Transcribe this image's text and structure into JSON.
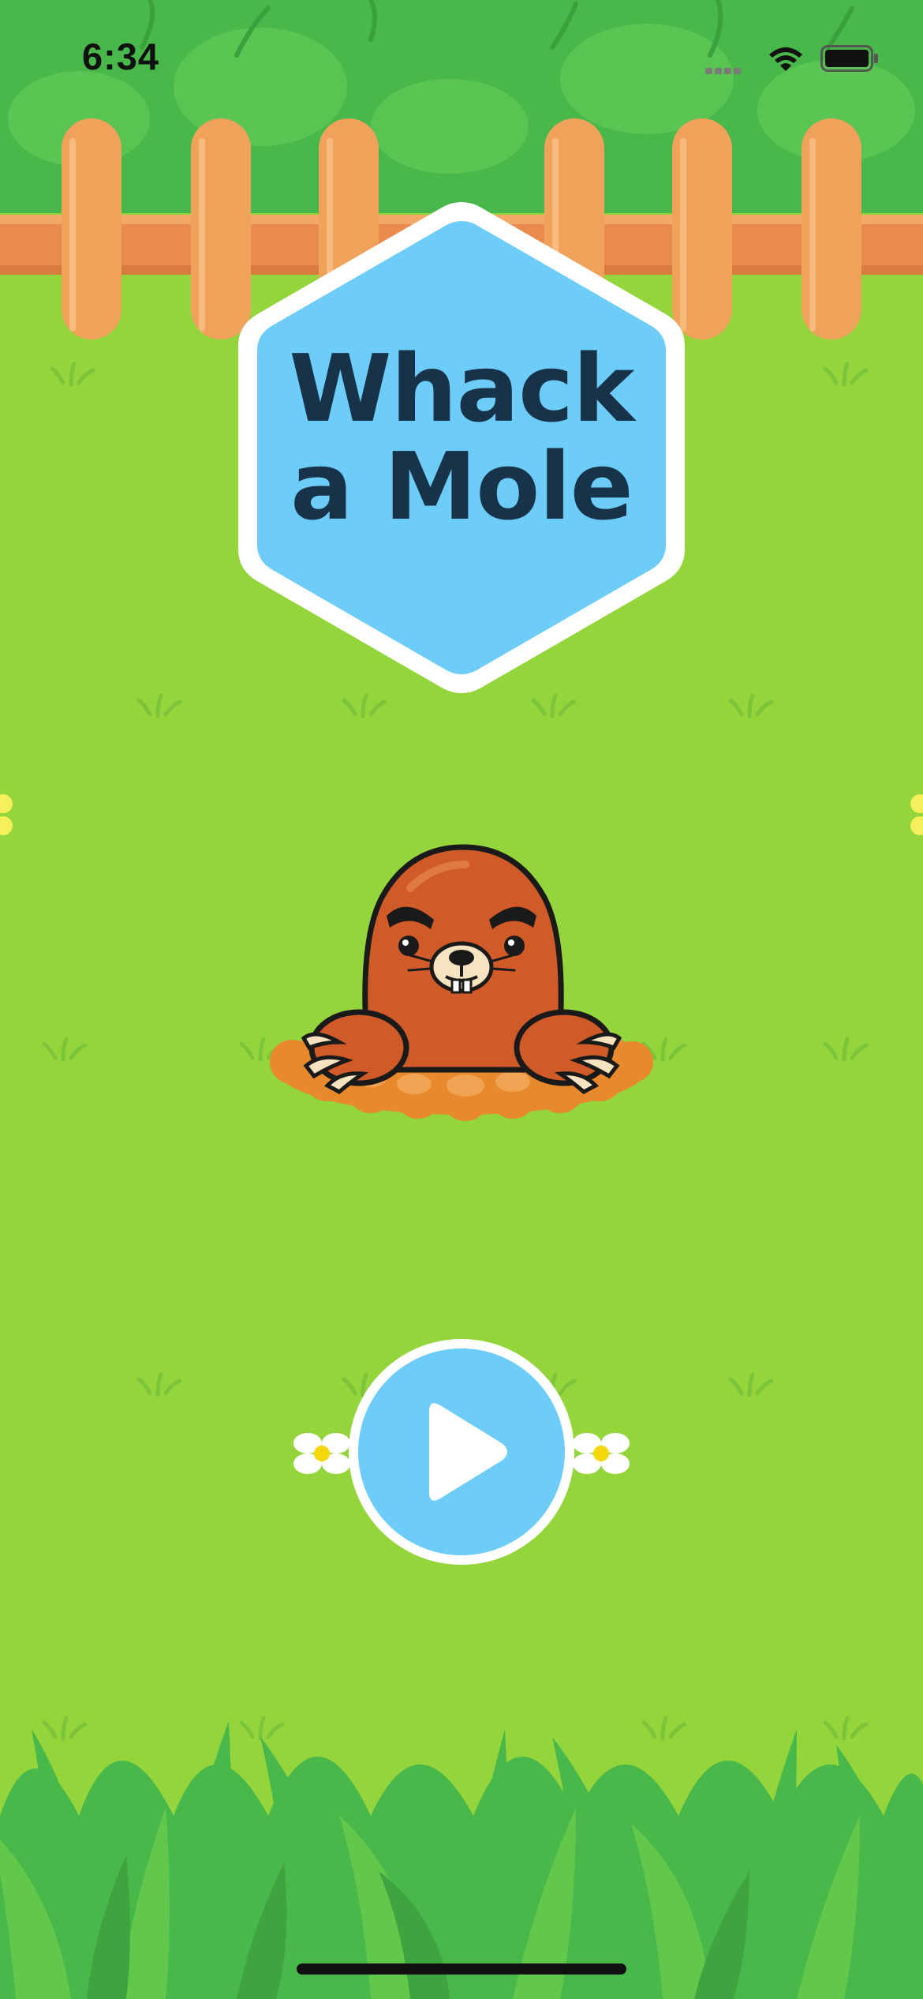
{
  "status_bar": {
    "time": "6:34",
    "icons": [
      "cellular-signal-icon",
      "wifi-icon",
      "battery-icon"
    ]
  },
  "game": {
    "title_line_1": "Whack",
    "title_line_2": "a Mole",
    "play_icon": "play-icon",
    "character": "mole-icon"
  },
  "colors": {
    "grass": "#95d53c",
    "bush": "#49b84a",
    "fence": "#f0a25a",
    "badge": "#6dcdf8",
    "title_text": "#173349",
    "mole": "#d05a28",
    "dirt": "#e8892e"
  }
}
